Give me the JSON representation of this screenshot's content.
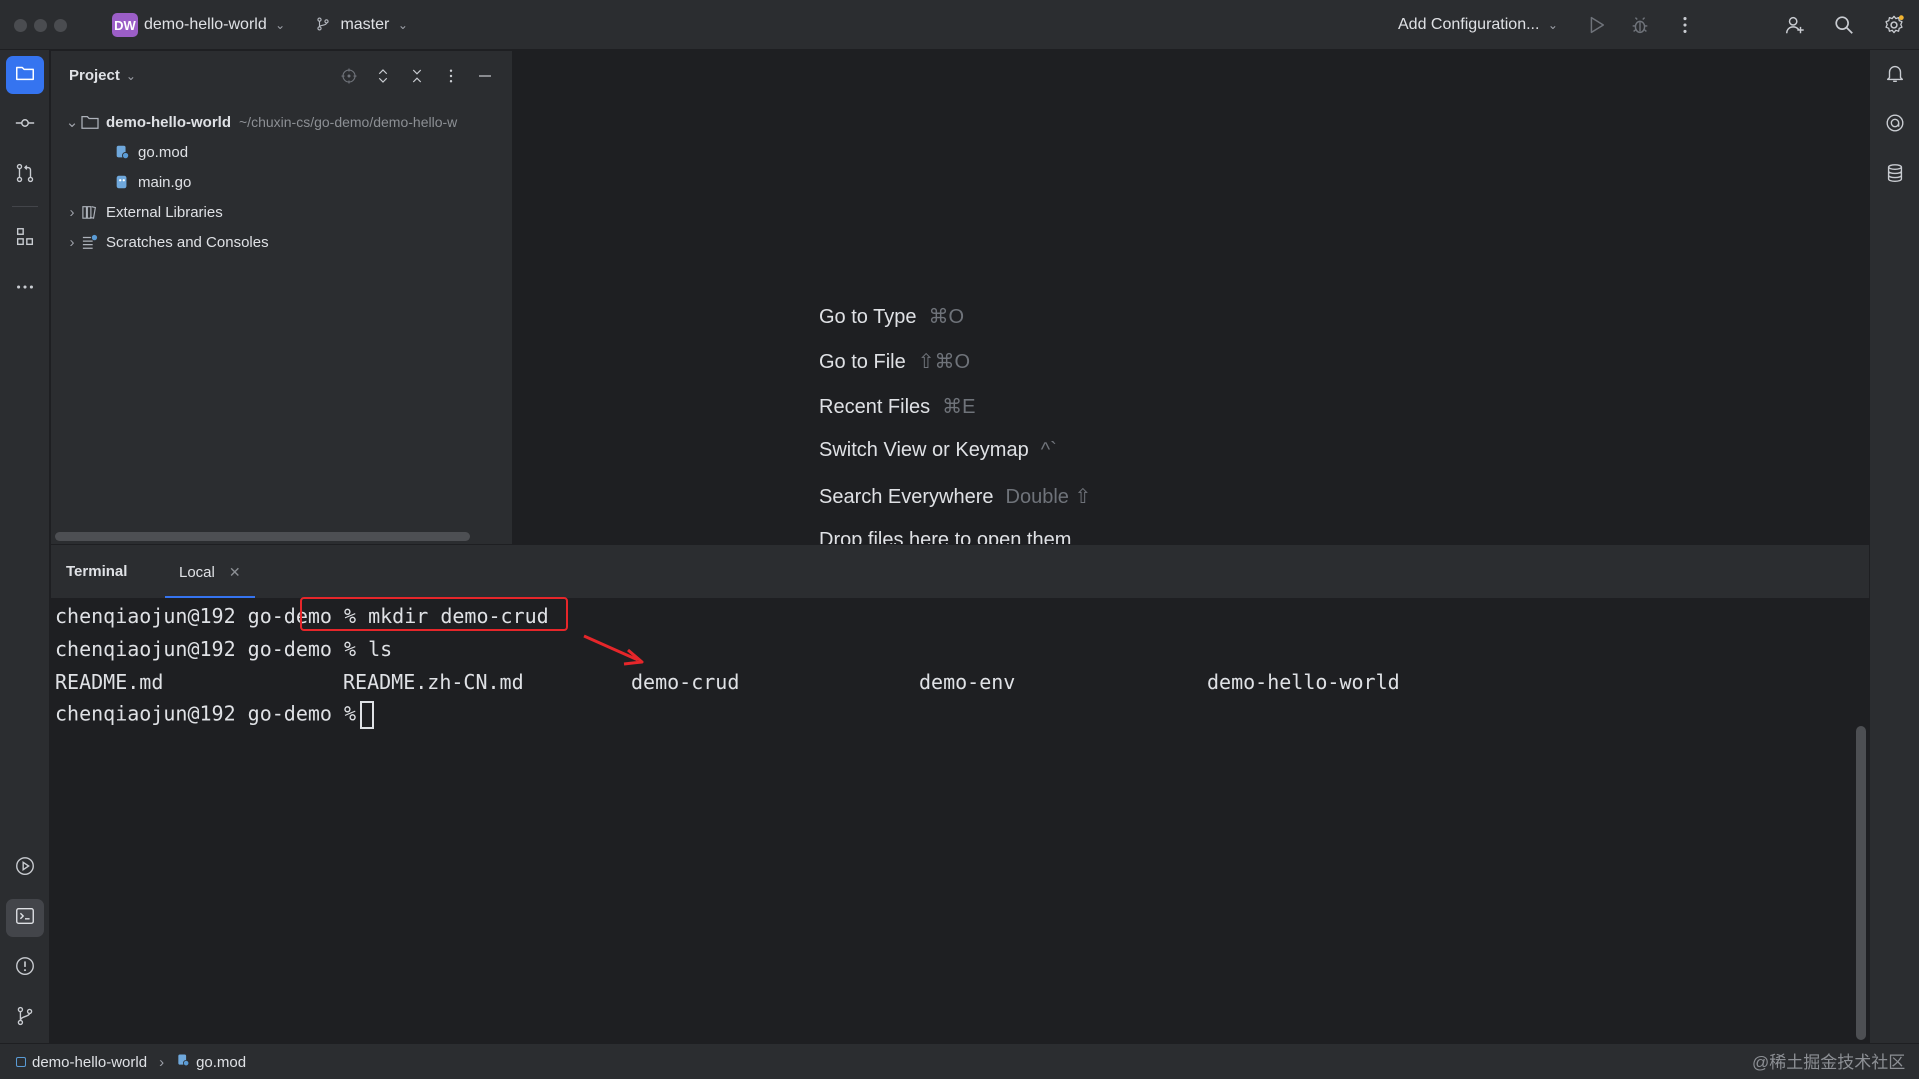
{
  "titlebar": {
    "project_badge": "DW",
    "project_name": "demo-hello-world",
    "branch": "master",
    "run_config": "Add Configuration..."
  },
  "project_panel": {
    "title": "Project",
    "tree": [
      {
        "label": "demo-hello-world",
        "path": "~/chuxin-cs/go-demo/demo-hello-w",
        "type": "folder",
        "expanded": true
      },
      {
        "label": "go.mod",
        "type": "file"
      },
      {
        "label": "main.go",
        "type": "file"
      },
      {
        "label": "External Libraries",
        "type": "library"
      },
      {
        "label": "Scratches and Consoles",
        "type": "scratches"
      }
    ]
  },
  "editor_hints": [
    {
      "label": "Go to Type",
      "shortcut": "⌘O"
    },
    {
      "label": "Go to File",
      "shortcut": "⇧⌘O"
    },
    {
      "label": "Recent Files",
      "shortcut": "⌘E"
    },
    {
      "label": "Switch View or Keymap",
      "shortcut": "^`"
    },
    {
      "label": "Search Everywhere",
      "shortcut": "Double ⇧"
    },
    {
      "label": "Drop files here to open them",
      "shortcut": ""
    }
  ],
  "terminal": {
    "title": "Terminal",
    "tab_label": "Local",
    "prompt": "chenqiaojun@192 go-demo %",
    "lines": [
      {
        "command": "mkdir demo-crud"
      },
      {
        "command": "ls"
      }
    ],
    "ls_output": [
      "README.md",
      "README.zh-CN.md",
      "demo-crud",
      "demo-env",
      "demo-hello-world"
    ]
  },
  "statusbar": {
    "crumb_project": "demo-hello-world",
    "crumb_file": "go.mod"
  },
  "watermark": "@稀土掘金技术社区",
  "colors": {
    "accent": "#3574f0",
    "highlight": "#e6262a",
    "project_badge": "#9b5ec7",
    "background": "#1e1f22",
    "panel": "#2b2d30"
  }
}
